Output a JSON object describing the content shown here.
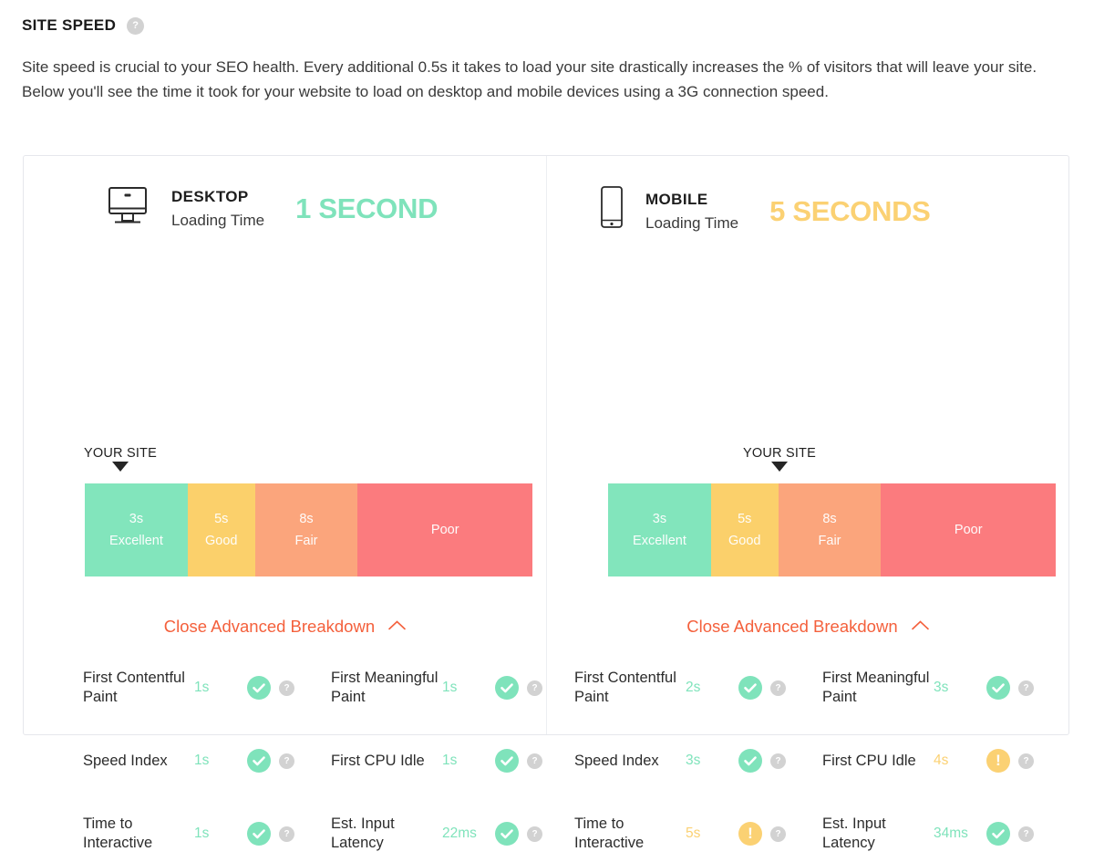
{
  "header": {
    "title": "SITE SPEED",
    "help_icon": "help-icon",
    "help_glyph": "?"
  },
  "intro": "Site speed is crucial to your SEO health. Every additional 0.5s it takes to load your site drastically increases the % of visitors that will leave your site. Below you'll see the time it took for your website to load on desktop and mobile devices using a 3G connection speed.",
  "colors": {
    "excellent": "#82e5bc",
    "good": "#fbd06b",
    "fair": "#fba57c",
    "poor": "#fb7b7e",
    "accent_orange": "#f4603c",
    "status_good": "#7fe3bb",
    "status_warn": "#fbd173",
    "help_gray": "#d2d2d2",
    "panel_border": "#e6e7ec"
  },
  "scale_segments": [
    {
      "time": "3s",
      "name": "Excellent",
      "color": "#82e5bc",
      "width_pct": 23
    },
    {
      "time": "5s",
      "name": "Good",
      "color": "#fbd06b",
      "width_pct": 15
    },
    {
      "time": "8s",
      "name": "Fair",
      "color": "#fba57c",
      "width_pct": 23
    },
    {
      "time": "",
      "name": "Poor",
      "color": "#fb7b7e",
      "width_pct": 39
    }
  ],
  "desktop": {
    "device_label": "DESKTOP",
    "device_sublabel": "Loading Time",
    "device_icon": "desktop-monitor-icon",
    "score": "1 SECOND",
    "score_state": "good",
    "marker_label": "YOUR SITE",
    "marker_position_pct": 8,
    "breakdown_toggle": "Close Advanced Breakdown",
    "breakdown_chevron": "chevron-up-icon",
    "metrics": [
      {
        "name": "First Contentful Paint",
        "value": "1s",
        "state": "good"
      },
      {
        "name": "First Meaningful Paint",
        "value": "1s",
        "state": "good"
      },
      {
        "name": "Speed Index",
        "value": "1s",
        "state": "good"
      },
      {
        "name": "First CPU Idle",
        "value": "1s",
        "state": "good"
      },
      {
        "name": "Time to Interactive",
        "value": "1s",
        "state": "good"
      },
      {
        "name": "Est. Input Latency",
        "value": "22ms",
        "state": "good"
      }
    ]
  },
  "mobile": {
    "device_label": "MOBILE",
    "device_sublabel": "Loading Time",
    "device_icon": "mobile-phone-icon",
    "score": "5 SECONDS",
    "score_state": "warn",
    "marker_label": "YOUR SITE",
    "marker_position_pct": 38,
    "breakdown_toggle": "Close Advanced Breakdown",
    "breakdown_chevron": "chevron-up-icon",
    "metrics": [
      {
        "name": "First Contentful Paint",
        "value": "2s",
        "state": "good"
      },
      {
        "name": "First Meaningful Paint",
        "value": "3s",
        "state": "good"
      },
      {
        "name": "Speed Index",
        "value": "3s",
        "state": "good"
      },
      {
        "name": "First CPU Idle",
        "value": "4s",
        "state": "warn"
      },
      {
        "name": "Time to Interactive",
        "value": "5s",
        "state": "warn"
      },
      {
        "name": "Est. Input Latency",
        "value": "34ms",
        "state": "good"
      }
    ]
  }
}
